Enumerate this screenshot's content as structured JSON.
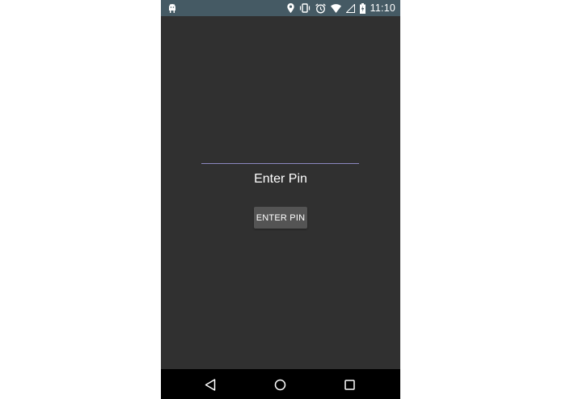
{
  "status_bar": {
    "time": "11:10",
    "icons": [
      "android-debug-icon",
      "location-icon",
      "vibrate-icon",
      "alarm-icon",
      "wifi-icon",
      "signal-icon",
      "battery-charging-icon"
    ],
    "background_color": "#455a64"
  },
  "main": {
    "pin_field": {
      "value": "",
      "placeholder": ""
    },
    "pin_label": "Enter Pin",
    "enter_button_label": "ENTER PIN",
    "background_color": "#303030",
    "accent_color": "#8c87c0"
  },
  "nav_bar": {
    "buttons": [
      "back-icon",
      "home-icon",
      "recents-icon"
    ]
  }
}
